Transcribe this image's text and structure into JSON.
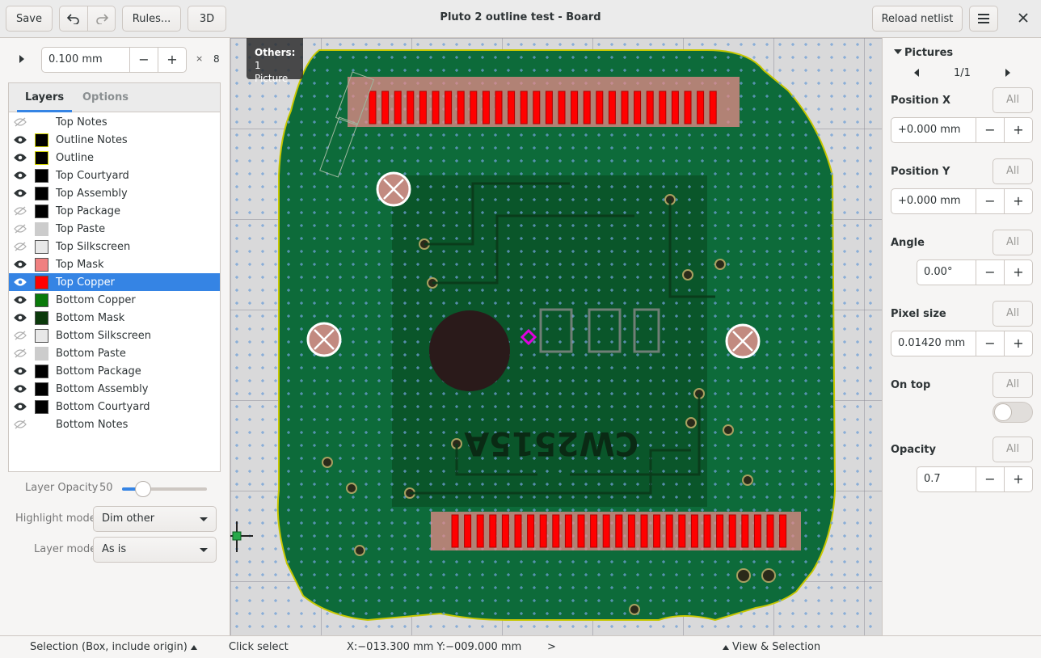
{
  "header": {
    "save_label": "Save",
    "undo_icon": "undo-icon",
    "redo_icon": "redo-icon",
    "rules_label": "Rules...",
    "view3d_label": "3D",
    "title": "Pluto 2 outline test - Board",
    "reload_label": "Reload netlist",
    "menu_icon": "hamburger-menu-icon",
    "close_icon": "close-icon"
  },
  "grid": {
    "spacing": "0.100 mm",
    "multiplier_symbol": "×",
    "multiplier": "8"
  },
  "layer_panel": {
    "tabs": [
      "Layers",
      "Options"
    ],
    "layers": [
      {
        "name": "Top Notes",
        "visible": false,
        "color": ""
      },
      {
        "name": "Outline Notes",
        "visible": true,
        "color": "#000000",
        "border": "#d4d400"
      },
      {
        "name": "Outline",
        "visible": true,
        "color": "#000000",
        "border": "#d4d400"
      },
      {
        "name": "Top Courtyard",
        "visible": true,
        "color": "#000000"
      },
      {
        "name": "Top Assembly",
        "visible": true,
        "color": "#000000"
      },
      {
        "name": "Top Package",
        "visible": false,
        "color": "#000000"
      },
      {
        "name": "Top Paste",
        "visible": false,
        "color": "#cccccc",
        "border": "#cccccc"
      },
      {
        "name": "Top Silkscreen",
        "visible": false,
        "color": "#e8e8e8"
      },
      {
        "name": "Top Mask",
        "visible": true,
        "color": "#f08080"
      },
      {
        "name": "Top Copper",
        "visible": true,
        "color": "#ff0000",
        "selected": true
      },
      {
        "name": "Bottom Copper",
        "visible": true,
        "color": "#0a7a0a"
      },
      {
        "name": "Bottom Mask",
        "visible": true,
        "color": "#0c3a0c"
      },
      {
        "name": "Bottom Silkscreen",
        "visible": false,
        "color": "#e8e8e8"
      },
      {
        "name": "Bottom Paste",
        "visible": false,
        "color": "#cccccc",
        "border": "#cccccc"
      },
      {
        "name": "Bottom Package",
        "visible": true,
        "color": "#000000"
      },
      {
        "name": "Bottom Assembly",
        "visible": true,
        "color": "#000000"
      },
      {
        "name": "Bottom Courtyard",
        "visible": true,
        "color": "#000000"
      },
      {
        "name": "Bottom Notes",
        "visible": false,
        "color": ""
      }
    ],
    "layer_opacity_label": "Layer Opacity",
    "layer_opacity_value": "50",
    "layer_opacity_fraction": 0.5,
    "highlight_mode_label": "Highlight mode",
    "highlight_mode_value": "Dim other",
    "layer_mode_label": "Layer mode",
    "layer_mode_value": "As is"
  },
  "canvas": {
    "overlay_title": "Others:",
    "overlay_sub": "1 Picture",
    "board_text": "CW2515A",
    "accent_colors": {
      "copper": "#ff0000",
      "board": "#0a8a3a",
      "origin": "#e000e0",
      "outline": "#d4d400"
    }
  },
  "pictures_panel": {
    "section_title": "Pictures",
    "pager": "1/1",
    "all_label": "All",
    "position_x_label": "Position X",
    "position_x_value": "+0.000 mm",
    "position_y_label": "Position Y",
    "position_y_value": "+0.000 mm",
    "angle_label": "Angle",
    "angle_value": "0.00°",
    "pixel_size_label": "Pixel size",
    "pixel_size_value": "0.01420 mm",
    "on_top_label": "On top",
    "on_top_state": false,
    "opacity_label": "Opacity",
    "opacity_value": "0.7"
  },
  "statusbar": {
    "selection_mode": "Selection (Box, include origin)",
    "click_select": "Click select",
    "coords": "X:−013.300 mm Y:−009.000 mm",
    "arrow": ">",
    "view_selection": "View & Selection"
  }
}
